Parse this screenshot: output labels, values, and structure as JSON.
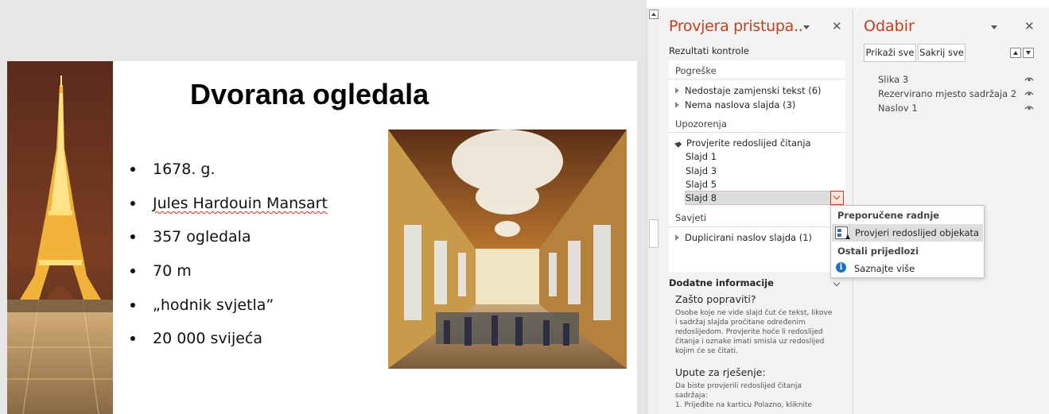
{
  "slide": {
    "title": "Dvorana ogledala",
    "bullets": [
      "1678. g.",
      "Jules Hardouin Mansart",
      "357 ogledala",
      "70 m",
      "„hodnik svjetla”",
      "20 000 svijeća"
    ]
  },
  "accessibility_pane": {
    "title": "Provjera pristupa..",
    "results_label": "Rezultati kontrole",
    "errors": {
      "heading": "Pogreške",
      "items": [
        "Nedostaje zamjenski tekst (6)",
        "Nema naslova slajda (3)"
      ]
    },
    "warnings": {
      "heading": "Upozorenja",
      "group": "Provjerite redoslijed čitanja",
      "slides": [
        "Slajd 1",
        "Slajd 3",
        "Slajd 5",
        "Slajd 8"
      ]
    },
    "tips": {
      "heading": "Savjeti",
      "items": [
        "Duplicirani naslov slajda (1)"
      ]
    },
    "additional_info": {
      "heading": "Dodatne informacije",
      "why_heading": "Zašto popraviti?",
      "why_lines": [
        "Osobe koje ne vide slajd čut će tekst, likove",
        "i sadržaj slajda pročitane određenim",
        "redoslijedom. Provjerite hoće li redoslijed",
        "čitanja i oznake imati smisla uz redoslijed",
        "kojim će se čitati."
      ],
      "how_heading": "Upute za rješenje:",
      "how_lines": [
        "Da biste provjerili redoslijed čitanja",
        "sadržaja:",
        "1. Prijeđite na karticu Polazno, kliknite"
      ]
    }
  },
  "popup": {
    "recommended_heading": "Preporučene radnje",
    "action_label": "Provjeri redoslijed objekata",
    "other_heading": "Ostali prijedlozi",
    "learn_label": "Saznajte više",
    "info_glyph": "i"
  },
  "selection_pane": {
    "title": "Odabir",
    "show_all": "Prikaži sve",
    "hide_all": "Sakrij sve",
    "items": [
      "Slika 3",
      "Rezervirano mjesto sadržaja 2",
      "Naslov 1"
    ]
  },
  "pane_close_glyph": "✕",
  "colors": {
    "accent": "#c43e1c",
    "pane_bg": "#f3f3f3",
    "canvas_bg": "#e6e6e6",
    "info_blue": "#1f6fc5"
  }
}
